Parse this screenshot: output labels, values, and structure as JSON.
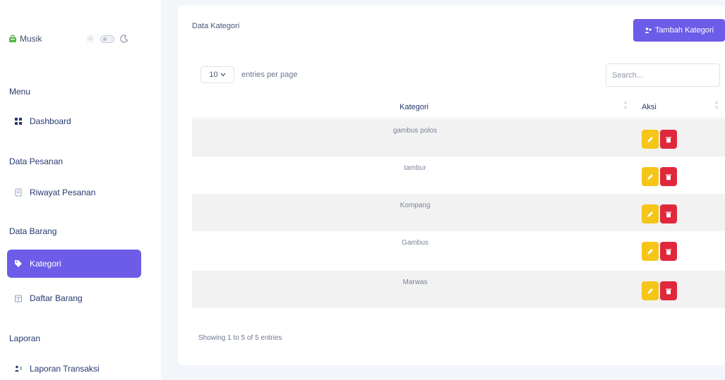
{
  "brand": {
    "name": "Musik"
  },
  "sidebar": {
    "sections": [
      {
        "title": "Menu"
      },
      {
        "title": "Data Pesanan"
      },
      {
        "title": "Data Barang"
      },
      {
        "title": "Laporan"
      }
    ],
    "items": [
      {
        "label": "Dashboard",
        "icon": "grid-icon"
      },
      {
        "label": "Riwayat Pesanan",
        "icon": "document-icon"
      },
      {
        "label": "Kategori",
        "icon": "tag-icon",
        "active": true
      },
      {
        "label": "Daftar Barang",
        "icon": "box-icon"
      },
      {
        "label": "Laporan Transaksi",
        "icon": "users-icon"
      }
    ]
  },
  "main": {
    "title": "Data Kategori",
    "add_button": "Tambah Kategori",
    "per_page_value": "10",
    "per_page_label": "entries per page",
    "search_placeholder": "Search...",
    "columns": [
      "Kategori",
      "Aksi"
    ],
    "rows": [
      {
        "kategori": "gambus polos"
      },
      {
        "kategori": "tambur"
      },
      {
        "kategori": "Kompang"
      },
      {
        "kategori": "Gambus"
      },
      {
        "kategori": "Marwas"
      }
    ],
    "footer": "Showing 1 to 5 of 5 entries"
  },
  "colors": {
    "accent": "#6c5ce7",
    "edit": "#f5c518",
    "delete": "#e0283d",
    "brand_icon": "#57b846"
  }
}
